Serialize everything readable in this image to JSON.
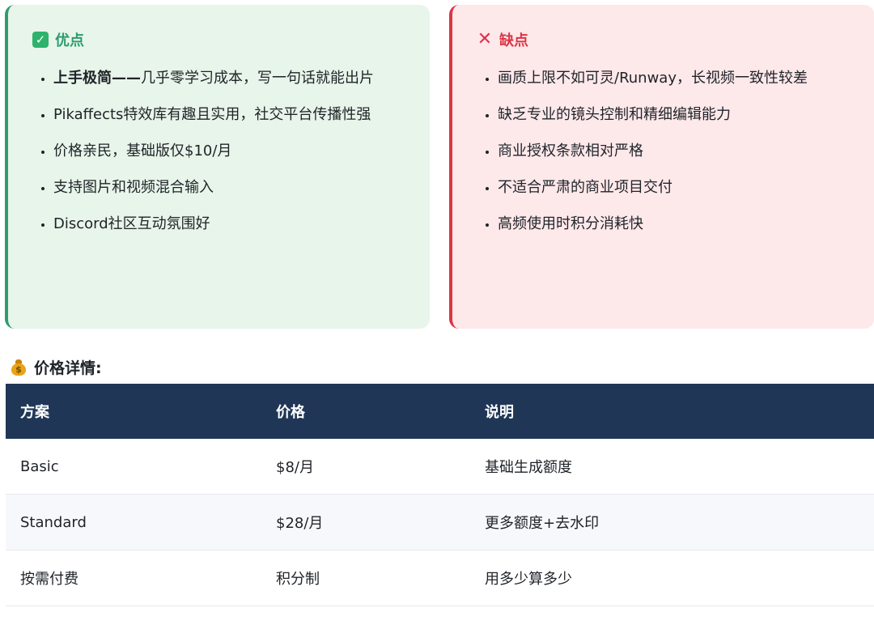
{
  "pros": {
    "title": "优点",
    "icon": "check-icon",
    "accent": "#2e9c6e",
    "items": [
      {
        "bold": "上手极简——",
        "text": "几乎零学习成本，写一句话就能出片"
      },
      {
        "bold": "",
        "text": "Pikaffects特效库有趣且实用，社交平台传播性强"
      },
      {
        "bold": "",
        "text": "价格亲民，基础版仅$10/月"
      },
      {
        "bold": "",
        "text": "支持图片和视频混合输入"
      },
      {
        "bold": "",
        "text": "Discord社区互动氛围好"
      }
    ]
  },
  "cons": {
    "title": "缺点",
    "icon": "cross-icon",
    "accent": "#dc3545",
    "items": [
      "画质上限不如可灵/Runway，长视频一致性较差",
      "缺乏专业的镜头控制和精细编辑能力",
      "商业授权条款相对严格",
      "不适合严肃的商业项目交付",
      "高频使用时积分消耗快"
    ]
  },
  "pricing": {
    "title": "价格详情:",
    "icon": "money-bag-icon",
    "headers": [
      "方案",
      "价格",
      "说明"
    ],
    "rows": [
      [
        "Basic",
        "$8/月",
        "基础生成额度"
      ],
      [
        "Standard",
        "$28/月",
        "更多额度+去水印"
      ],
      [
        "按需付费",
        "积分制",
        "用多少算多少"
      ]
    ],
    "header_color": "#1f3656"
  }
}
